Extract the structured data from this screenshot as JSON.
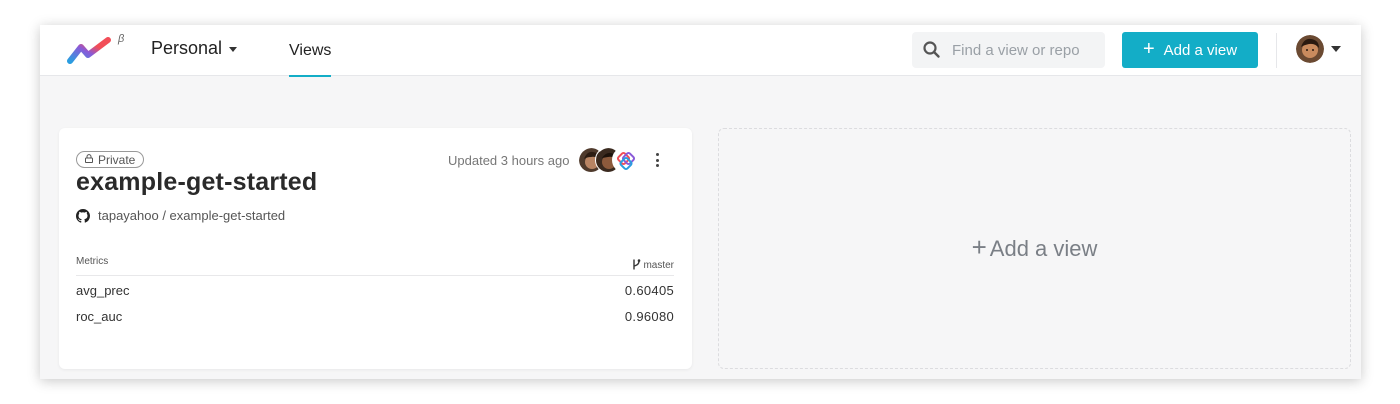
{
  "header": {
    "beta_mark": "β",
    "workspace": "Personal",
    "nav_views": "Views",
    "search_placeholder": "Find a view or repo",
    "add_view_label": "Add a view",
    "add_view_plus": "+"
  },
  "card": {
    "visibility": "Private",
    "lock_glyph": "🔒",
    "title": "example-get-started",
    "repo": "tapayahoo / example-get-started",
    "updated": "Updated 3 hours ago",
    "metrics_label": "Metrics",
    "branch_glyph": "ᚹ",
    "branch": "master",
    "metrics": [
      {
        "name": "avg_prec",
        "value": "0.60405"
      },
      {
        "name": "roc_auc",
        "value": "0.96080"
      }
    ]
  },
  "placeholder": {
    "plus": "+",
    "label": "Add a view"
  },
  "colors": {
    "accent": "#13adc7",
    "logo_blue": "#2a9de0",
    "logo_red": "#f24e58"
  },
  "icons": {
    "search": "search-icon",
    "github": "github-icon",
    "lock": "lock-icon",
    "branch": "git-branch-icon",
    "more": "more-vertical-icon"
  }
}
